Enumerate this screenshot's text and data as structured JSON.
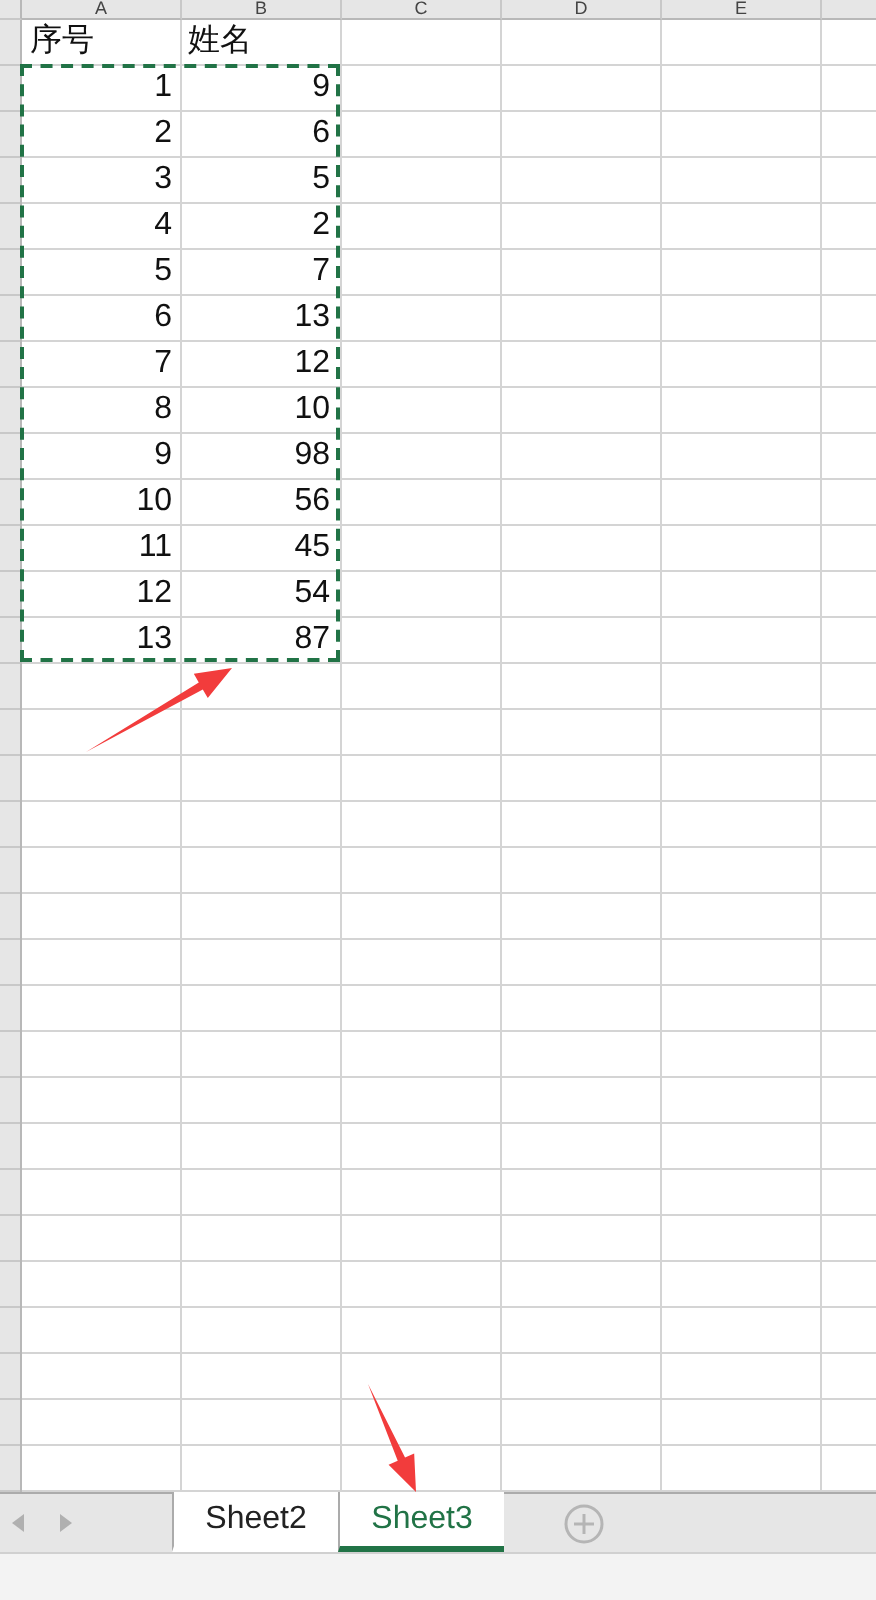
{
  "columns": [
    "A",
    "B",
    "C",
    "D",
    "E"
  ],
  "header_row": [
    "序号",
    "姓名"
  ],
  "rows": [
    [
      "1",
      "9"
    ],
    [
      "2",
      "6"
    ],
    [
      "3",
      "5"
    ],
    [
      "4",
      "2"
    ],
    [
      "5",
      "7"
    ],
    [
      "6",
      "13"
    ],
    [
      "7",
      "12"
    ],
    [
      "8",
      "10"
    ],
    [
      "9",
      "98"
    ],
    [
      "10",
      "56"
    ],
    [
      "11",
      "45"
    ],
    [
      "12",
      "54"
    ],
    [
      "13",
      "87"
    ]
  ],
  "copy_marquee": true,
  "sheet_tabs": [
    {
      "label": "Sheet2",
      "selected": false
    },
    {
      "label": "Sheet3",
      "selected": true
    }
  ]
}
